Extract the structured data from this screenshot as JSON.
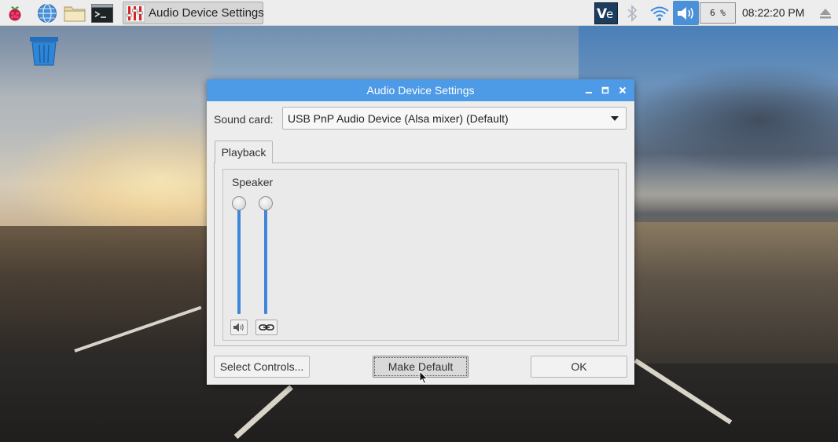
{
  "taskbar": {
    "launchers": [
      {
        "name": "raspberry-menu",
        "icon": "raspberry-icon"
      },
      {
        "name": "web-browser",
        "icon": "globe-icon"
      },
      {
        "name": "file-manager",
        "icon": "folder-icon"
      },
      {
        "name": "terminal",
        "icon": "terminal-icon"
      }
    ],
    "active_task": {
      "label": "Audio Device Settings",
      "icon": "mixer-icon"
    },
    "tray": {
      "vnc_icon": "vnc-icon",
      "bluetooth_icon": "bluetooth-icon",
      "wifi_icon": "wifi-icon",
      "volume_icon": "volume-icon",
      "cpu_usage": "6 %",
      "clock": "08:22:20 PM",
      "eject_icon": "eject-icon"
    }
  },
  "desktop": {
    "trash_icon": "trash-icon"
  },
  "dialog": {
    "title": "Audio Device Settings",
    "sound_card_label": "Sound card:",
    "sound_card_value": "USB PnP Audio Device (Alsa mixer) (Default)",
    "tabs": [
      {
        "label": "Playback"
      }
    ],
    "group_label": "Speaker",
    "sliders": [
      {
        "channel": "left",
        "level_percent": 100
      },
      {
        "channel": "right",
        "level_percent": 100
      }
    ],
    "mute_icon": "speaker-icon",
    "lock_icon": "chain-link-icon",
    "buttons": {
      "select_controls": "Select Controls...",
      "make_default": "Make Default",
      "ok": "OK"
    }
  },
  "colors": {
    "titlebar": "#4d9ae6",
    "slider_track": "#3d86d9",
    "taskbar": "#ededed"
  }
}
